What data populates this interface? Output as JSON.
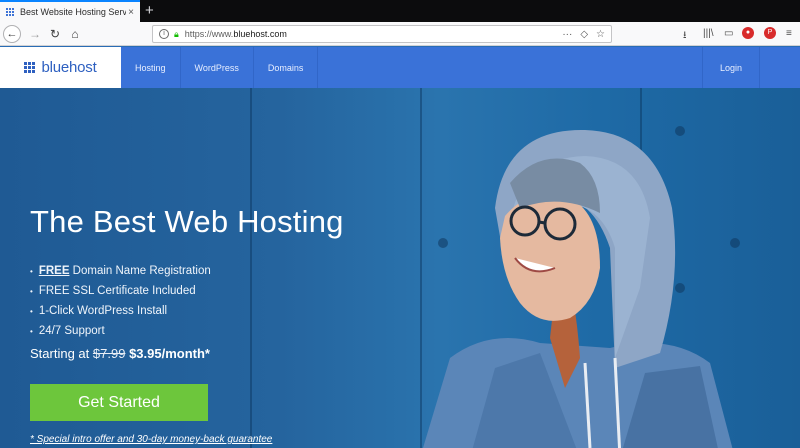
{
  "browser": {
    "tab_title": "Best Website Hosting Services",
    "tab_close": "×",
    "new_tab": "+",
    "url_prefix": "https://www.",
    "url_domain": "bluehost.com",
    "back": "←",
    "forward": "→",
    "reload": "↻",
    "home": "⌂",
    "url_more": "···",
    "pocket": "◇",
    "bookmark": "☆",
    "library": "|||\\",
    "sidebar": "▭",
    "menu": "≡"
  },
  "site": {
    "logo_text": "bluehost",
    "nav": [
      "Hosting",
      "WordPress",
      "Domains"
    ],
    "login": "Login"
  },
  "hero": {
    "headline": "The Best Web Hosting",
    "features": [
      {
        "prefix": "",
        "emph": "FREE",
        "rest": " Domain Name Registration"
      },
      {
        "prefix": "FREE SSL Certificate Included",
        "emph": "",
        "rest": ""
      },
      {
        "prefix": "1-Click WordPress Install",
        "emph": "",
        "rest": ""
      },
      {
        "prefix": "24/7 Support",
        "emph": "",
        "rest": ""
      }
    ],
    "price_label": "Starting at",
    "price_old": "$7.99",
    "price_new": "$3.95/month*",
    "cta": "Get Started",
    "note": "* Special intro offer and 30-day money-back guarantee"
  },
  "colors": {
    "accent_blue": "#3a72d8",
    "cta_green": "#6dc63c"
  }
}
